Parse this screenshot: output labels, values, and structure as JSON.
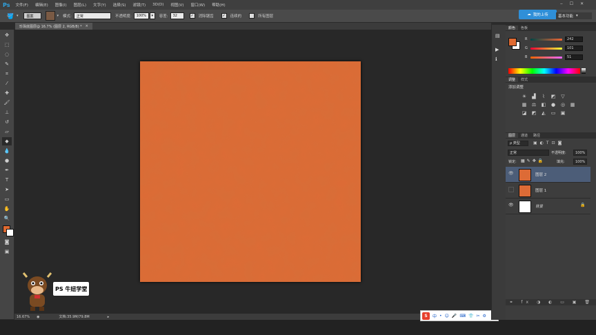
{
  "app": {
    "logo": "Ps",
    "doc_tab": "珍珠底图层@ 16.7% (图层 2, RGB/8) *",
    "tab_close": "×"
  },
  "menu": [
    "文件(F)",
    "编辑(E)",
    "图像(I)",
    "图层(L)",
    "文字(Y)",
    "选择(S)",
    "滤镜(T)",
    "3D(D)",
    "视图(V)",
    "窗口(W)",
    "帮助(H)"
  ],
  "options": {
    "preset": "图案",
    "mode_label": "模式:",
    "mode_value": "正常",
    "opacity_label": "不透明度:",
    "opacity_value": "100%",
    "tolerance_label": "容差:",
    "tolerance_value": "32",
    "antialias": "消除锯齿",
    "contiguous": "连续的",
    "all_layers": "所有图层",
    "check_mark": "✓"
  },
  "top_right": {
    "cloud_button": "我的上传",
    "workspace": "基本功能"
  },
  "status": {
    "zoom": "16.67%",
    "doc": "文档:35.9M/79.8M"
  },
  "color_panel": {
    "tabs": [
      "颜色",
      "色板"
    ],
    "channels": [
      {
        "label": "R",
        "value": "242"
      },
      {
        "label": "G",
        "value": "101"
      },
      {
        "label": "B",
        "value": "51"
      }
    ],
    "foreground": "#e06a31",
    "background": "#ffffff"
  },
  "adjust_panel": {
    "tabs": [
      "调整",
      "样式"
    ],
    "title": "添加调整"
  },
  "layers_panel": {
    "tabs": [
      "图层",
      "通道",
      "路径"
    ],
    "filter_label": "ρ 类型",
    "blend_mode": "正常",
    "opacity_label": "不透明度:",
    "opacity_value": "100%",
    "lock_label": "锁定:",
    "fill_label": "填充:",
    "fill_value": "100%",
    "layers": [
      {
        "name": "图层 2",
        "visible": true,
        "selected": true,
        "thumb": "#dd6b36"
      },
      {
        "name": "图层 1",
        "visible": false,
        "selected": false,
        "thumb": "#dd6b36"
      },
      {
        "name": "背景",
        "visible": true,
        "selected": false,
        "thumb": "#ffffff"
      }
    ]
  },
  "watermark": {
    "text": "PS 牛妞学堂"
  },
  "ime": {
    "logo": "S",
    "items": [
      "中",
      "•",
      "☺",
      "🎤",
      "⌨",
      "👕",
      "✂",
      "⚙"
    ]
  },
  "colors": {
    "canvas": "#dd6b36",
    "accent": "#2f8fd8"
  }
}
